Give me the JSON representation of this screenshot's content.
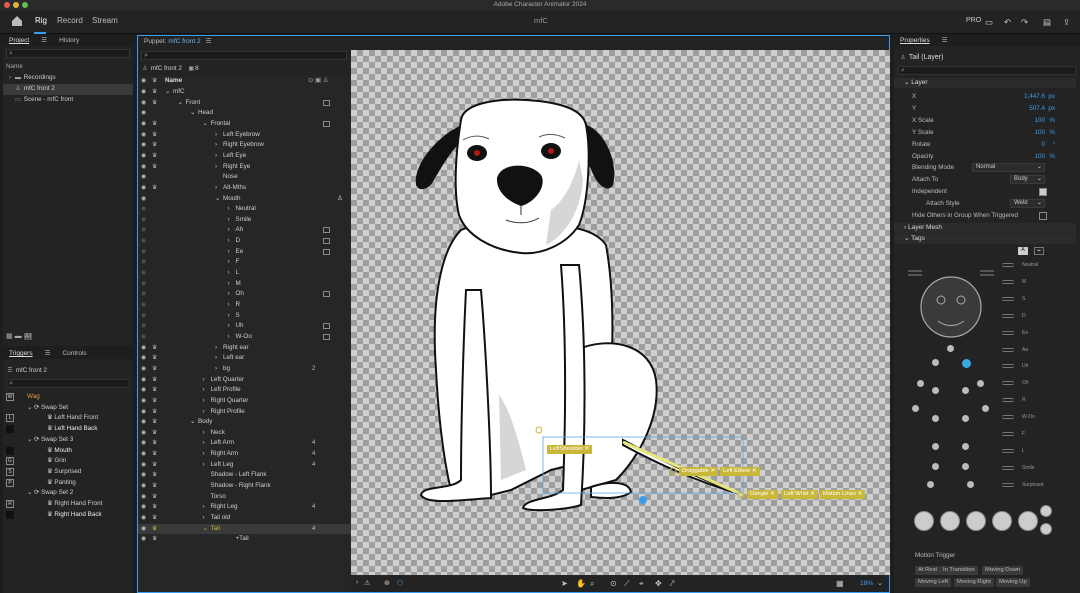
{
  "app": {
    "title": "Adobe Character Animator 2024",
    "doc_title": "mfC",
    "pro_label": "PRO"
  },
  "menu": {
    "tabs": [
      "Rig",
      "Record",
      "Stream"
    ]
  },
  "project": {
    "tabs": [
      "Project",
      "History"
    ],
    "col_name": "Name",
    "items": [
      "Recordings",
      "mfC front 2",
      "Scene - mfC front"
    ]
  },
  "triggers": {
    "tabs": [
      "Triggers",
      "Controls"
    ],
    "puppet": "mfC front 2",
    "rows": [
      {
        "key": "W",
        "label": "Wag",
        "indent": 1,
        "active": true
      },
      {
        "key": "",
        "label": "Swap Set",
        "indent": 1
      },
      {
        "key": "L",
        "label": "Left Hand Front",
        "indent": 2
      },
      {
        "key": "",
        "label": "Left Hand Back",
        "indent": 2,
        "bright": true
      },
      {
        "key": "",
        "label": "Swap Set 3",
        "indent": 1
      },
      {
        "key": "",
        "label": "Mouth",
        "indent": 2,
        "bright": true
      },
      {
        "key": "G",
        "label": "Grin",
        "indent": 2
      },
      {
        "key": "S",
        "label": "Surprised",
        "indent": 2
      },
      {
        "key": "P",
        "label": "Panting",
        "indent": 2
      },
      {
        "key": "",
        "label": "Swap Set 2",
        "indent": 1
      },
      {
        "key": "R",
        "label": "Right Hand Front",
        "indent": 2
      },
      {
        "key": "",
        "label": "Right Hand Back",
        "indent": 2,
        "bright": true
      }
    ]
  },
  "puppet": {
    "tab_prefix": "Puppet:",
    "tab_name": "mfC front 2",
    "header_name": "mfC front 2",
    "header_count": "8",
    "col_name": "Name",
    "rows": [
      {
        "label": "mfC",
        "indent": 1,
        "arrow": "v",
        "badge": false,
        "num": ""
      },
      {
        "label": "Front",
        "indent": 2,
        "arrow": "v",
        "badge": true,
        "num": ""
      },
      {
        "label": "Head",
        "indent": 3,
        "arrow": "v",
        "badge": false,
        "num": ""
      },
      {
        "label": "Frontal",
        "indent": 4,
        "arrow": "v",
        "badge": true,
        "num": ""
      },
      {
        "label": "Left Eyebrow",
        "indent": 5,
        "arrow": ">",
        "badge": false,
        "num": ""
      },
      {
        "label": "Right Eyebrow",
        "indent": 5,
        "arrow": ">",
        "badge": false,
        "num": ""
      },
      {
        "label": "Left Eye",
        "indent": 5,
        "arrow": ">",
        "badge": false,
        "num": ""
      },
      {
        "label": "Right Eye",
        "indent": 5,
        "arrow": ">",
        "badge": false,
        "num": ""
      },
      {
        "label": "Nose",
        "indent": 5,
        "arrow": "",
        "badge": false,
        "num": ""
      },
      {
        "label": "Alt-Mths",
        "indent": 5,
        "arrow": ">",
        "badge": false,
        "num": ""
      },
      {
        "label": "Mouth",
        "indent": 5,
        "arrow": "v",
        "badge": false,
        "num": ""
      },
      {
        "label": "Neutral",
        "indent": 6,
        "arrow": ">",
        "badge": false,
        "num": ""
      },
      {
        "label": "Smile",
        "indent": 6,
        "arrow": ">",
        "badge": false,
        "num": ""
      },
      {
        "label": "Ah",
        "indent": 6,
        "arrow": ">",
        "badge": true,
        "num": ""
      },
      {
        "label": "D",
        "indent": 6,
        "arrow": ">",
        "badge": true,
        "num": ""
      },
      {
        "label": "Ee",
        "indent": 6,
        "arrow": ">",
        "badge": true,
        "num": ""
      },
      {
        "label": "F",
        "indent": 6,
        "arrow": ">",
        "badge": false,
        "num": ""
      },
      {
        "label": "L",
        "indent": 6,
        "arrow": ">",
        "badge": false,
        "num": ""
      },
      {
        "label": "M",
        "indent": 6,
        "arrow": ">",
        "badge": false,
        "num": ""
      },
      {
        "label": "Oh",
        "indent": 6,
        "arrow": ">",
        "badge": true,
        "num": ""
      },
      {
        "label": "R",
        "indent": 6,
        "arrow": ">",
        "badge": false,
        "num": ""
      },
      {
        "label": "S",
        "indent": 6,
        "arrow": ">",
        "badge": false,
        "num": ""
      },
      {
        "label": "Uh",
        "indent": 6,
        "arrow": ">",
        "badge": true,
        "num": ""
      },
      {
        "label": "W-Oo",
        "indent": 6,
        "arrow": ">",
        "badge": true,
        "num": ""
      },
      {
        "label": "Right ear",
        "indent": 5,
        "arrow": ">",
        "badge": false,
        "num": ""
      },
      {
        "label": "Left ear",
        "indent": 5,
        "arrow": ">",
        "badge": false,
        "num": ""
      },
      {
        "label": "bg",
        "indent": 5,
        "arrow": ">",
        "badge": false,
        "num": "2"
      },
      {
        "label": "Left Quarter",
        "indent": 4,
        "arrow": ">",
        "badge": false,
        "num": ""
      },
      {
        "label": "Left Profile",
        "indent": 4,
        "arrow": ">",
        "badge": false,
        "num": ""
      },
      {
        "label": "Right Quarter",
        "indent": 4,
        "arrow": ">",
        "badge": false,
        "num": ""
      },
      {
        "label": "Right Profile",
        "indent": 4,
        "arrow": ">",
        "badge": false,
        "num": ""
      },
      {
        "label": "Body",
        "indent": 3,
        "arrow": "v",
        "badge": false,
        "num": ""
      },
      {
        "label": "Neck",
        "indent": 4,
        "arrow": ">",
        "badge": false,
        "num": ""
      },
      {
        "label": "Left Arm",
        "indent": 4,
        "arrow": ">",
        "badge": false,
        "num": "4"
      },
      {
        "label": "Right Arm",
        "indent": 4,
        "arrow": ">",
        "badge": false,
        "num": "4"
      },
      {
        "label": "Left Leg",
        "indent": 4,
        "arrow": ">",
        "badge": false,
        "num": "4"
      },
      {
        "label": "Shadow - Left Flank",
        "indent": 4,
        "arrow": "",
        "badge": false,
        "num": ""
      },
      {
        "label": "Shadow - Right Flank",
        "indent": 4,
        "arrow": "",
        "badge": false,
        "num": ""
      },
      {
        "label": "Torso",
        "indent": 4,
        "arrow": "",
        "badge": false,
        "num": ""
      },
      {
        "label": "Right Leg",
        "indent": 4,
        "arrow": ">",
        "badge": false,
        "num": "4"
      },
      {
        "label": "Tail old",
        "indent": 4,
        "arrow": ">",
        "badge": false,
        "num": ""
      },
      {
        "label": "Tail",
        "indent": 4,
        "arrow": "v",
        "badge": false,
        "num": "4",
        "selected": true
      },
      {
        "label": "+Tail",
        "indent": 6,
        "arrow": "",
        "badge": false,
        "num": ""
      }
    ]
  },
  "canvas": {
    "handle_tags": [
      "LeftShoulder",
      "Draggable",
      "Left Elbow",
      "Dangle",
      "Left Wrist",
      "Motion Lines"
    ],
    "zoom": "18%"
  },
  "properties": {
    "title": "Properties",
    "layer_name": "Tail (Layer)",
    "layer_section": "Layer",
    "fields": [
      {
        "label": "X",
        "value": "1,447.6",
        "unit": "px"
      },
      {
        "label": "Y",
        "value": "507.4",
        "unit": "px"
      },
      {
        "label": "X Scale",
        "value": "100",
        "unit": "%"
      },
      {
        "label": "Y Scale",
        "value": "100",
        "unit": "%"
      },
      {
        "label": "Rotate",
        "value": "0",
        "unit": "°"
      },
      {
        "label": "Opacity",
        "value": "100",
        "unit": "%"
      }
    ],
    "blending_label": "Blending Mode",
    "blending_value": "Normal",
    "attach_to_label": "Attach To",
    "attach_to_value": "Body",
    "independent_label": "Independent",
    "attach_style_label": "Attach Style",
    "attach_style_value": "Weld",
    "hide_others_label": "Hide Others in Group When Triggered",
    "layer_mesh": "Layer Mesh",
    "tags": "Tags",
    "viseme_labels": [
      "Neutral",
      "M",
      "S",
      "D",
      "Ee",
      "Aa",
      "Uh",
      "Oh",
      "R",
      "W-Oo",
      "F",
      "L",
      "Smile",
      "Surprised"
    ],
    "motion_trigger_label": "Motion Trigger",
    "motion_buttons": [
      "At Rest",
      "In Transition",
      "Moving Down",
      "Moving Left",
      "Moving Right",
      "Moving Up"
    ]
  },
  "colors": {
    "accent": "#3a9df0",
    "handle": "#c9b73a",
    "panel": "#232323",
    "active_tab": "#6cb8f5",
    "wag": "#e0a040"
  }
}
